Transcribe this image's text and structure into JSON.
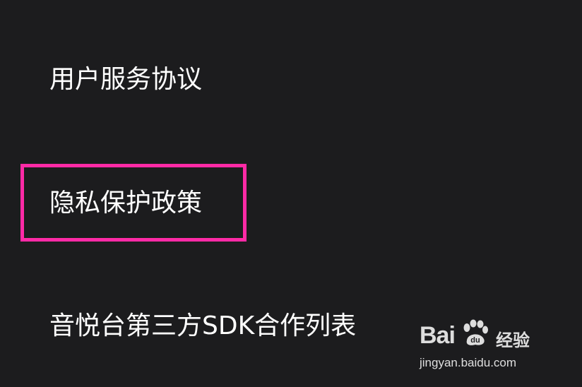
{
  "menu": {
    "items": [
      {
        "label": "用户服务协议"
      },
      {
        "label": "隐私保护政策",
        "highlighted": true
      },
      {
        "label": "音悦台第三方SDK合作列表"
      }
    ]
  },
  "highlight": {
    "color": "#ff2aa6"
  },
  "watermark": {
    "brand": "Bai",
    "brand_tail": "du",
    "label": "经验",
    "url": "jingyan.baidu.com",
    "icon": "baidu-paw-icon"
  },
  "colors": {
    "background": "#1c1c1e",
    "text": "#ffffff"
  }
}
